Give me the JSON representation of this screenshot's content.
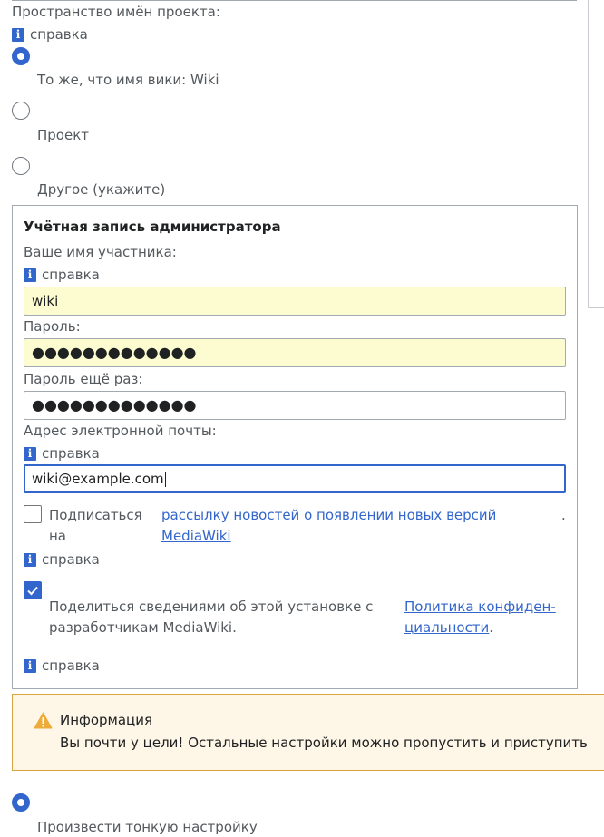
{
  "project_namespace": {
    "label": "Пространство имён проекта:",
    "help_label": "справка",
    "options": [
      {
        "label": "То же, что имя вики: Wiki",
        "checked": true
      },
      {
        "label": "Проект",
        "checked": false
      },
      {
        "label": "Другое (укажите)",
        "checked": false
      }
    ]
  },
  "admin_account": {
    "legend": "Учётная запись администратора",
    "username": {
      "label": "Ваше имя участника:",
      "help_label": "справка",
      "value": "wiki"
    },
    "password": {
      "label": "Пароль:",
      "value": "●●●●●●●●●●●●●"
    },
    "password_again": {
      "label": "Пароль ещё раз:",
      "value": "●●●●●●●●●●●●●"
    },
    "email": {
      "label": "Адрес электронной почты:",
      "help_label": "справка",
      "value": "wiki@example.com"
    },
    "subscribe": {
      "checked": false,
      "text_line1": "Подписаться",
      "text_line2": "на",
      "link_line1": "рассылку новостей о появлении новых версий",
      "link_line2": "MediaWiki",
      "period": ".",
      "help_label": "справка"
    },
    "share": {
      "checked": true,
      "text_line1": "Поделиться сведениями об этой установке с",
      "text_line2": "разработчикам MediaWiki.",
      "link_line1": "Политика конфиден-",
      "link_line2": "циальности",
      "period": ".",
      "help_label": "справка"
    }
  },
  "notice": {
    "title": "Информация",
    "text": "Вы почти у цели! Остальные настройки можно пропустить и приступить"
  },
  "next_option": {
    "label": "Произвести тонкую настройку",
    "checked": true
  },
  "colors": {
    "accent": "#3366cc",
    "autofill": "#fdfbd0",
    "notice_bg": "#fef6e7",
    "notice_border": "#d9a440",
    "warning": "#edab3a"
  }
}
